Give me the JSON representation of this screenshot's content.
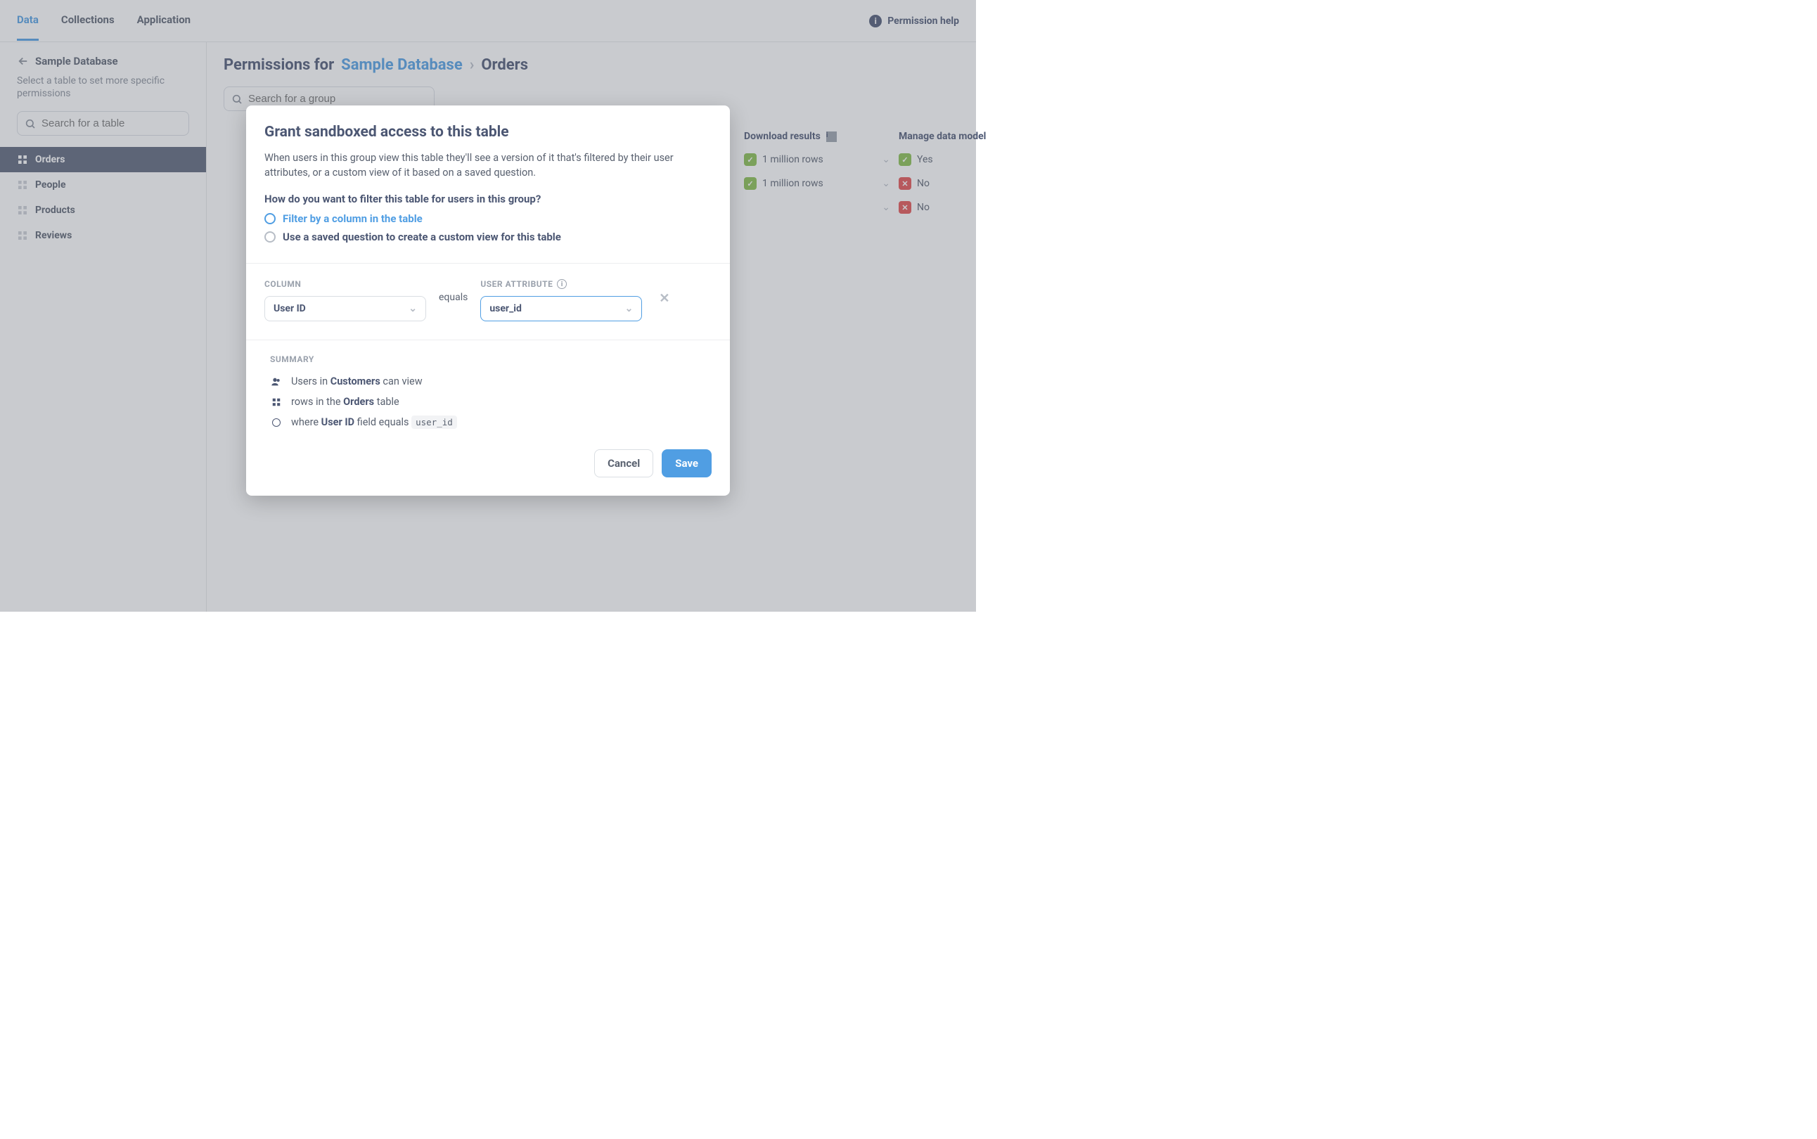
{
  "top_tabs": {
    "data": "Data",
    "collections": "Collections",
    "application": "Application"
  },
  "perm_help": "Permission help",
  "sidebar": {
    "back": "Sample Database",
    "subtitle": "Select a table to set more specific permissions",
    "search_placeholder": "Search for a table",
    "items": [
      "Orders",
      "People",
      "Products",
      "Reviews"
    ]
  },
  "breadcrumb": {
    "prefix": "Permissions for",
    "db": "Sample Database",
    "table": "Orders"
  },
  "main_search_placeholder": "Search for a group",
  "columns": {
    "download": "Download results",
    "manage": "Manage data model"
  },
  "rows": [
    {
      "download": "1 million rows",
      "manage_ok": true,
      "manage": "Yes"
    },
    {
      "download": "1 million rows",
      "manage_ok": false,
      "manage": "No"
    },
    {
      "download": "",
      "manage_ok": false,
      "manage": "No"
    }
  ],
  "modal": {
    "title": "Grant sandboxed access to this table",
    "desc": "When users in this group view this table they'll see a version of it that's filtered by their user attributes, or a custom view of it based on a saved question.",
    "question": "How do you want to filter this table for users in this group?",
    "opt1": "Filter by a column in the table",
    "opt2": "Use a saved question to create a custom view for this table",
    "col_label": "COLUMN",
    "attr_label": "USER ATTRIBUTE",
    "col_value": "User ID",
    "equals": "equals",
    "attr_value": "user_id",
    "summary_label": "SUMMARY",
    "s1_pre": "Users in ",
    "s1_b": "Customers",
    "s1_post": " can view",
    "s2_pre": "rows in the ",
    "s2_b": "Orders",
    "s2_post": " table",
    "s3_pre": "where ",
    "s3_b": "User ID",
    "s3_mid": " field equals ",
    "s3_code": "user_id",
    "cancel": "Cancel",
    "save": "Save"
  }
}
